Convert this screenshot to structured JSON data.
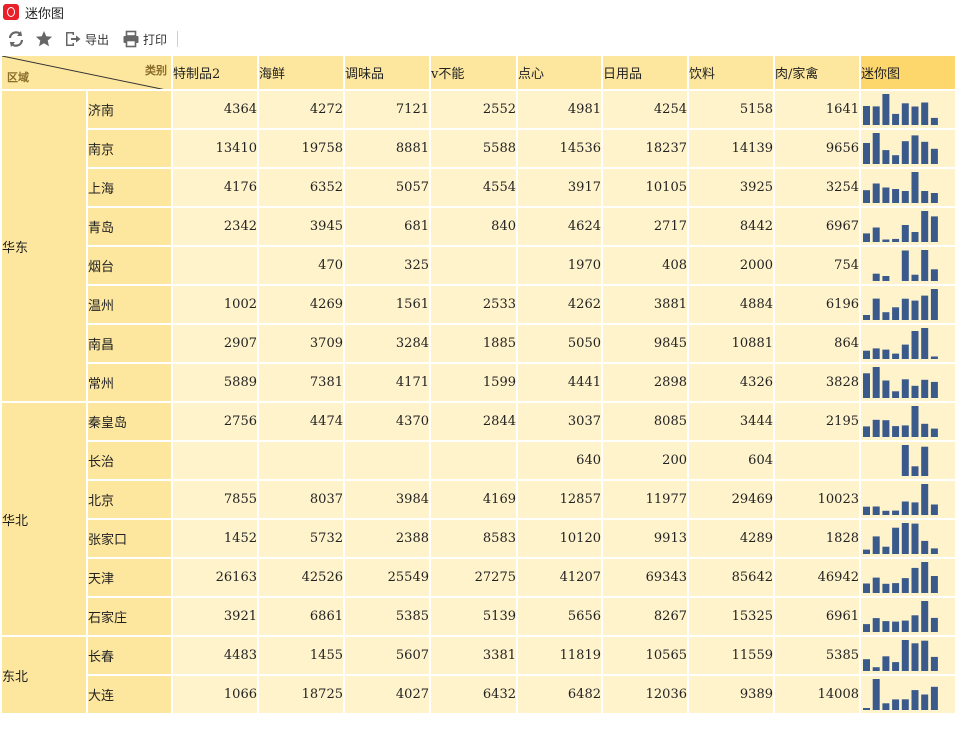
{
  "window": {
    "title": "迷你图"
  },
  "toolbar": {
    "refresh_icon": "refresh-icon",
    "favorite_icon": "star-icon",
    "export_label": "导出",
    "print_label": "打印"
  },
  "colors": {
    "header": "#fde79f",
    "header_mini": "#fdd66c",
    "cell": "#fff3cc",
    "bar": "#3a5a8c"
  },
  "table": {
    "corner_category": "类别",
    "corner_region": "区域",
    "columns": [
      "特制品2",
      "海鲜",
      "调味品",
      "v不能",
      "点心",
      "日用品",
      "饮料",
      "肉/家禽"
    ],
    "mini_column": "迷你图",
    "regions": [
      {
        "name": "华东",
        "rows": [
          {
            "city": "济南",
            "values": [
              4364,
              4272,
              7121,
              2552,
              4981,
              4254,
              5158,
              1641
            ]
          },
          {
            "city": "南京",
            "values": [
              13410,
              19758,
              8881,
              5588,
              14536,
              18237,
              14139,
              9656
            ]
          },
          {
            "city": "上海",
            "values": [
              4176,
              6352,
              5057,
              4554,
              3917,
              10105,
              3925,
              3254
            ]
          },
          {
            "city": "青岛",
            "values": [
              2342,
              3945,
              681,
              840,
              4624,
              2717,
              8442,
              6967
            ]
          },
          {
            "city": "烟台",
            "values": [
              null,
              470,
              325,
              null,
              1970,
              408,
              2000,
              754
            ]
          },
          {
            "city": "温州",
            "values": [
              1002,
              4269,
              1561,
              2533,
              4262,
              3881,
              4884,
              6196
            ]
          },
          {
            "city": "南昌",
            "values": [
              2907,
              3709,
              3284,
              1885,
              5050,
              9845,
              10881,
              864
            ]
          },
          {
            "city": "常州",
            "values": [
              5889,
              7381,
              4171,
              1599,
              4441,
              2898,
              4326,
              3828
            ]
          }
        ]
      },
      {
        "name": "华北",
        "rows": [
          {
            "city": "秦皇岛",
            "values": [
              2756,
              4474,
              4370,
              2844,
              3037,
              8085,
              3444,
              2195
            ]
          },
          {
            "city": "长治",
            "values": [
              null,
              null,
              null,
              null,
              640,
              200,
              604,
              null
            ]
          },
          {
            "city": "北京",
            "values": [
              7855,
              8037,
              3984,
              4169,
              12857,
              11977,
              29469,
              10023
            ]
          },
          {
            "city": "张家口",
            "values": [
              1452,
              5732,
              2388,
              8583,
              10120,
              9913,
              4289,
              1828
            ]
          },
          {
            "city": "天津",
            "values": [
              26163,
              42526,
              25549,
              27275,
              41207,
              69343,
              85642,
              46942
            ]
          },
          {
            "city": "石家庄",
            "values": [
              3921,
              6861,
              5385,
              5139,
              5656,
              8267,
              15325,
              6961
            ]
          }
        ]
      },
      {
        "name": "东北",
        "rows": [
          {
            "city": "长春",
            "values": [
              4483,
              1455,
              5607,
              3381,
              11819,
              10565,
              11559,
              5385
            ]
          },
          {
            "city": "大连",
            "values": [
              1066,
              18725,
              4027,
              6432,
              6482,
              12036,
              9389,
              14008
            ]
          }
        ]
      }
    ]
  }
}
